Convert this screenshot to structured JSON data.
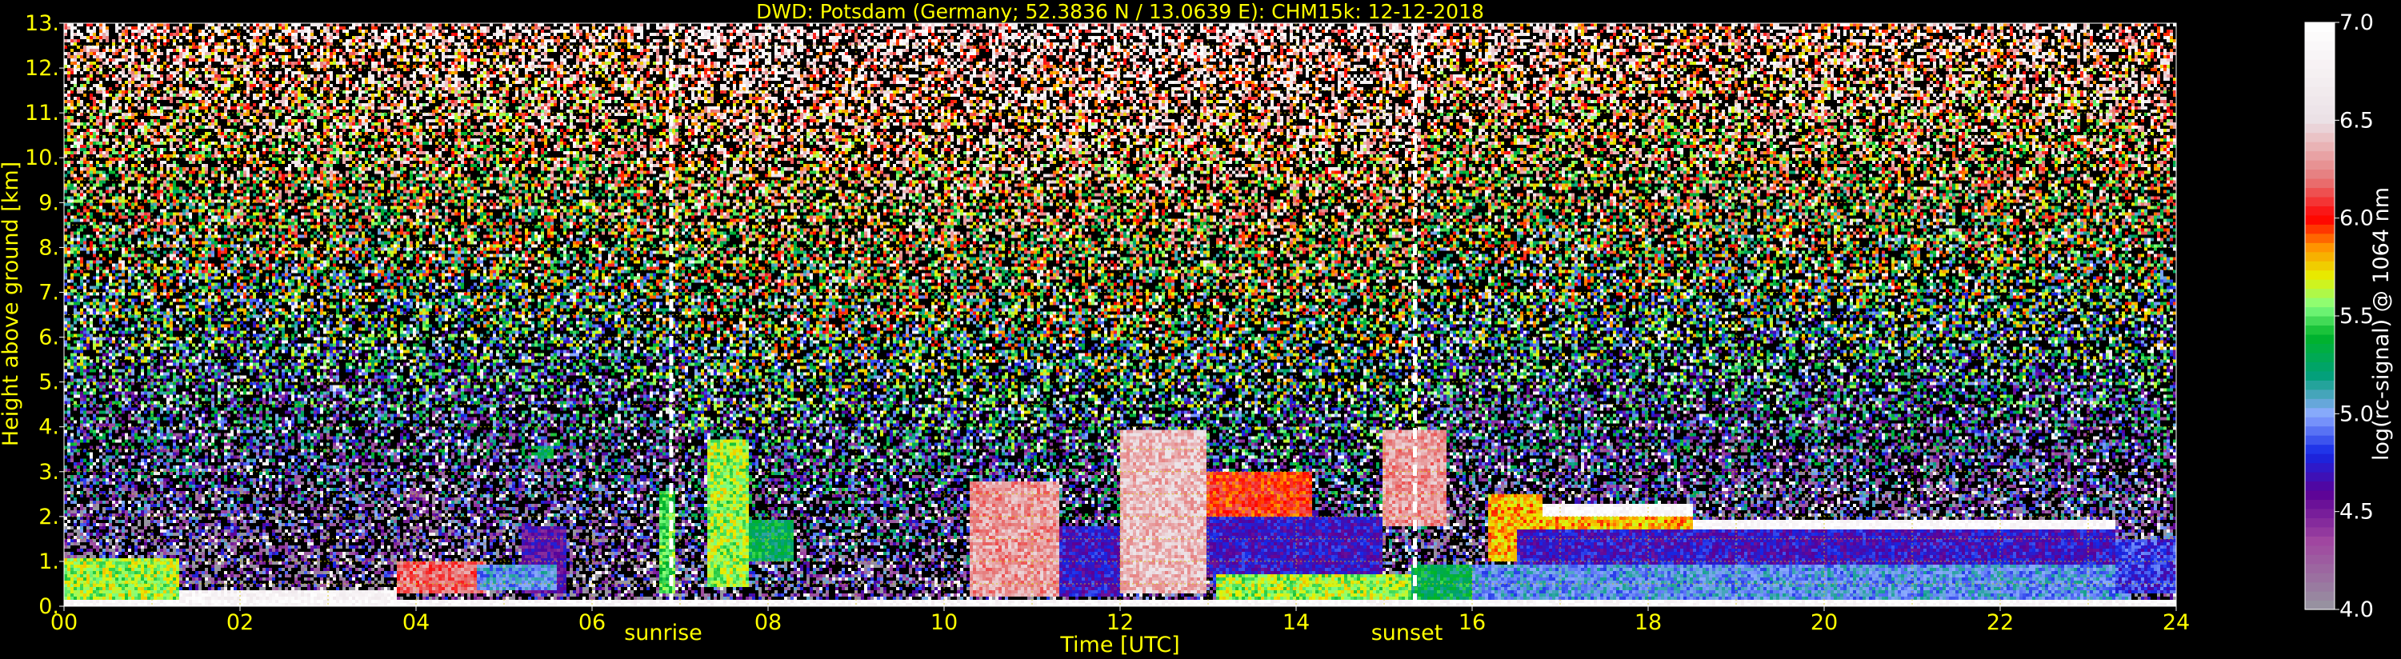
{
  "chart_data": {
    "type": "heatmap",
    "title": "DWD: Potsdam (Germany; 52.3836 N / 13.0639 E):    CHM15k: 12-12-2018",
    "xlabel": "Time [UTC]",
    "ylabel": "Height above ground [km]",
    "colorbar_label": "log(rc-signal) @ 1064 nm",
    "xlim": [
      0,
      24
    ],
    "ylim": [
      0,
      13
    ],
    "x_ticks": [
      0,
      2,
      4,
      6,
      8,
      10,
      12,
      14,
      16,
      18,
      20,
      22,
      24
    ],
    "x_tick_labels": [
      "00",
      "02",
      "04",
      "06",
      "08",
      "10",
      "12",
      "14",
      "16",
      "18",
      "20",
      "22",
      "24"
    ],
    "y_ticks": [
      0,
      1,
      2,
      3,
      4,
      5,
      6,
      7,
      8,
      9,
      10,
      11,
      12,
      13
    ],
    "y_tick_labels": [
      "0.",
      "1.",
      "2.",
      "3.",
      "4.",
      "5.",
      "6.",
      "7.",
      "8.",
      "9.",
      "10.",
      "11.",
      "12.",
      "13."
    ],
    "grid": true,
    "colorbar": {
      "min": 4.0,
      "max": 7.0,
      "ticks": [
        4.0,
        4.5,
        5.0,
        5.5,
        6.0,
        6.5,
        7.0
      ],
      "tick_labels": [
        "4.0",
        "4.5",
        "5.0",
        "5.5",
        "6.0",
        "6.5",
        "7.0"
      ]
    },
    "events": [
      {
        "label": "sunrise",
        "time": 6.9
      },
      {
        "label": "sunset",
        "time": 15.35
      }
    ],
    "layers": [
      {
        "t0": 0.0,
        "t1": 1.3,
        "h0": 0.05,
        "h1": 1.1,
        "v": 5.6
      },
      {
        "t0": 1.3,
        "t1": 3.8,
        "h0": 0.05,
        "h1": 0.35,
        "v": 6.8
      },
      {
        "t0": 3.8,
        "t1": 4.8,
        "h0": 0.3,
        "h1": 1.0,
        "v": 6.2
      },
      {
        "t0": 5.2,
        "t1": 5.7,
        "h0": 0.3,
        "h1": 1.8,
        "v": 4.6
      },
      {
        "t0": 5.4,
        "t1": 5.55,
        "h0": 3.3,
        "h1": 3.6,
        "v": 5.3
      },
      {
        "t0": 4.7,
        "t1": 5.6,
        "h0": 0.35,
        "h1": 0.9,
        "v": 5.0
      },
      {
        "t0": 6.75,
        "t1": 6.95,
        "h0": 0.3,
        "h1": 2.6,
        "v": 5.5
      },
      {
        "t0": 7.3,
        "t1": 7.8,
        "h0": 0.4,
        "h1": 3.7,
        "v": 5.6
      },
      {
        "t0": 7.8,
        "t1": 8.3,
        "h0": 1.0,
        "h1": 1.9,
        "v": 5.3
      },
      {
        "t0": 10.3,
        "t1": 11.3,
        "h0": 0.2,
        "h1": 2.8,
        "v": 6.3
      },
      {
        "t0": 11.3,
        "t1": 12.0,
        "h0": 0.2,
        "h1": 1.8,
        "v": 4.7
      },
      {
        "t0": 12.0,
        "t1": 13.0,
        "h0": 0.3,
        "h1": 3.9,
        "v": 6.4
      },
      {
        "t0": 13.0,
        "t1": 14.2,
        "h0": 2.0,
        "h1": 3.0,
        "v": 6.0
      },
      {
        "t0": 13.1,
        "t1": 15.3,
        "h0": 0.05,
        "h1": 0.7,
        "v": 5.6
      },
      {
        "t0": 13.0,
        "t1": 15.0,
        "h0": 0.7,
        "h1": 2.0,
        "v": 4.7
      },
      {
        "t0": 15.0,
        "t1": 15.7,
        "h0": 1.8,
        "h1": 3.9,
        "v": 6.3
      },
      {
        "t0": 15.3,
        "t1": 16.2,
        "h0": 0.1,
        "h1": 0.9,
        "v": 5.3
      },
      {
        "t0": 16.2,
        "t1": 16.8,
        "h0": 1.0,
        "h1": 2.5,
        "v": 5.8
      },
      {
        "t0": 16.8,
        "t1": 18.5,
        "h0": 2.0,
        "h1": 2.3,
        "v": 6.9
      },
      {
        "t0": 16.8,
        "t1": 18.5,
        "h0": 1.2,
        "h1": 2.0,
        "v": 5.8
      },
      {
        "t0": 18.5,
        "t1": 23.3,
        "h0": 1.7,
        "h1": 1.9,
        "v": 6.9
      },
      {
        "t0": 16.5,
        "t1": 23.3,
        "h0": 0.9,
        "h1": 1.7,
        "v": 4.7
      },
      {
        "t0": 16.0,
        "t1": 23.5,
        "h0": 0.1,
        "h1": 0.9,
        "v": 5.0
      },
      {
        "t0": 23.3,
        "t1": 24.0,
        "h0": 0.3,
        "h1": 1.5,
        "v": 4.8
      },
      {
        "t0": 0.0,
        "t1": 24.0,
        "h0": 0.0,
        "h1": 0.12,
        "v": 6.9
      }
    ]
  }
}
